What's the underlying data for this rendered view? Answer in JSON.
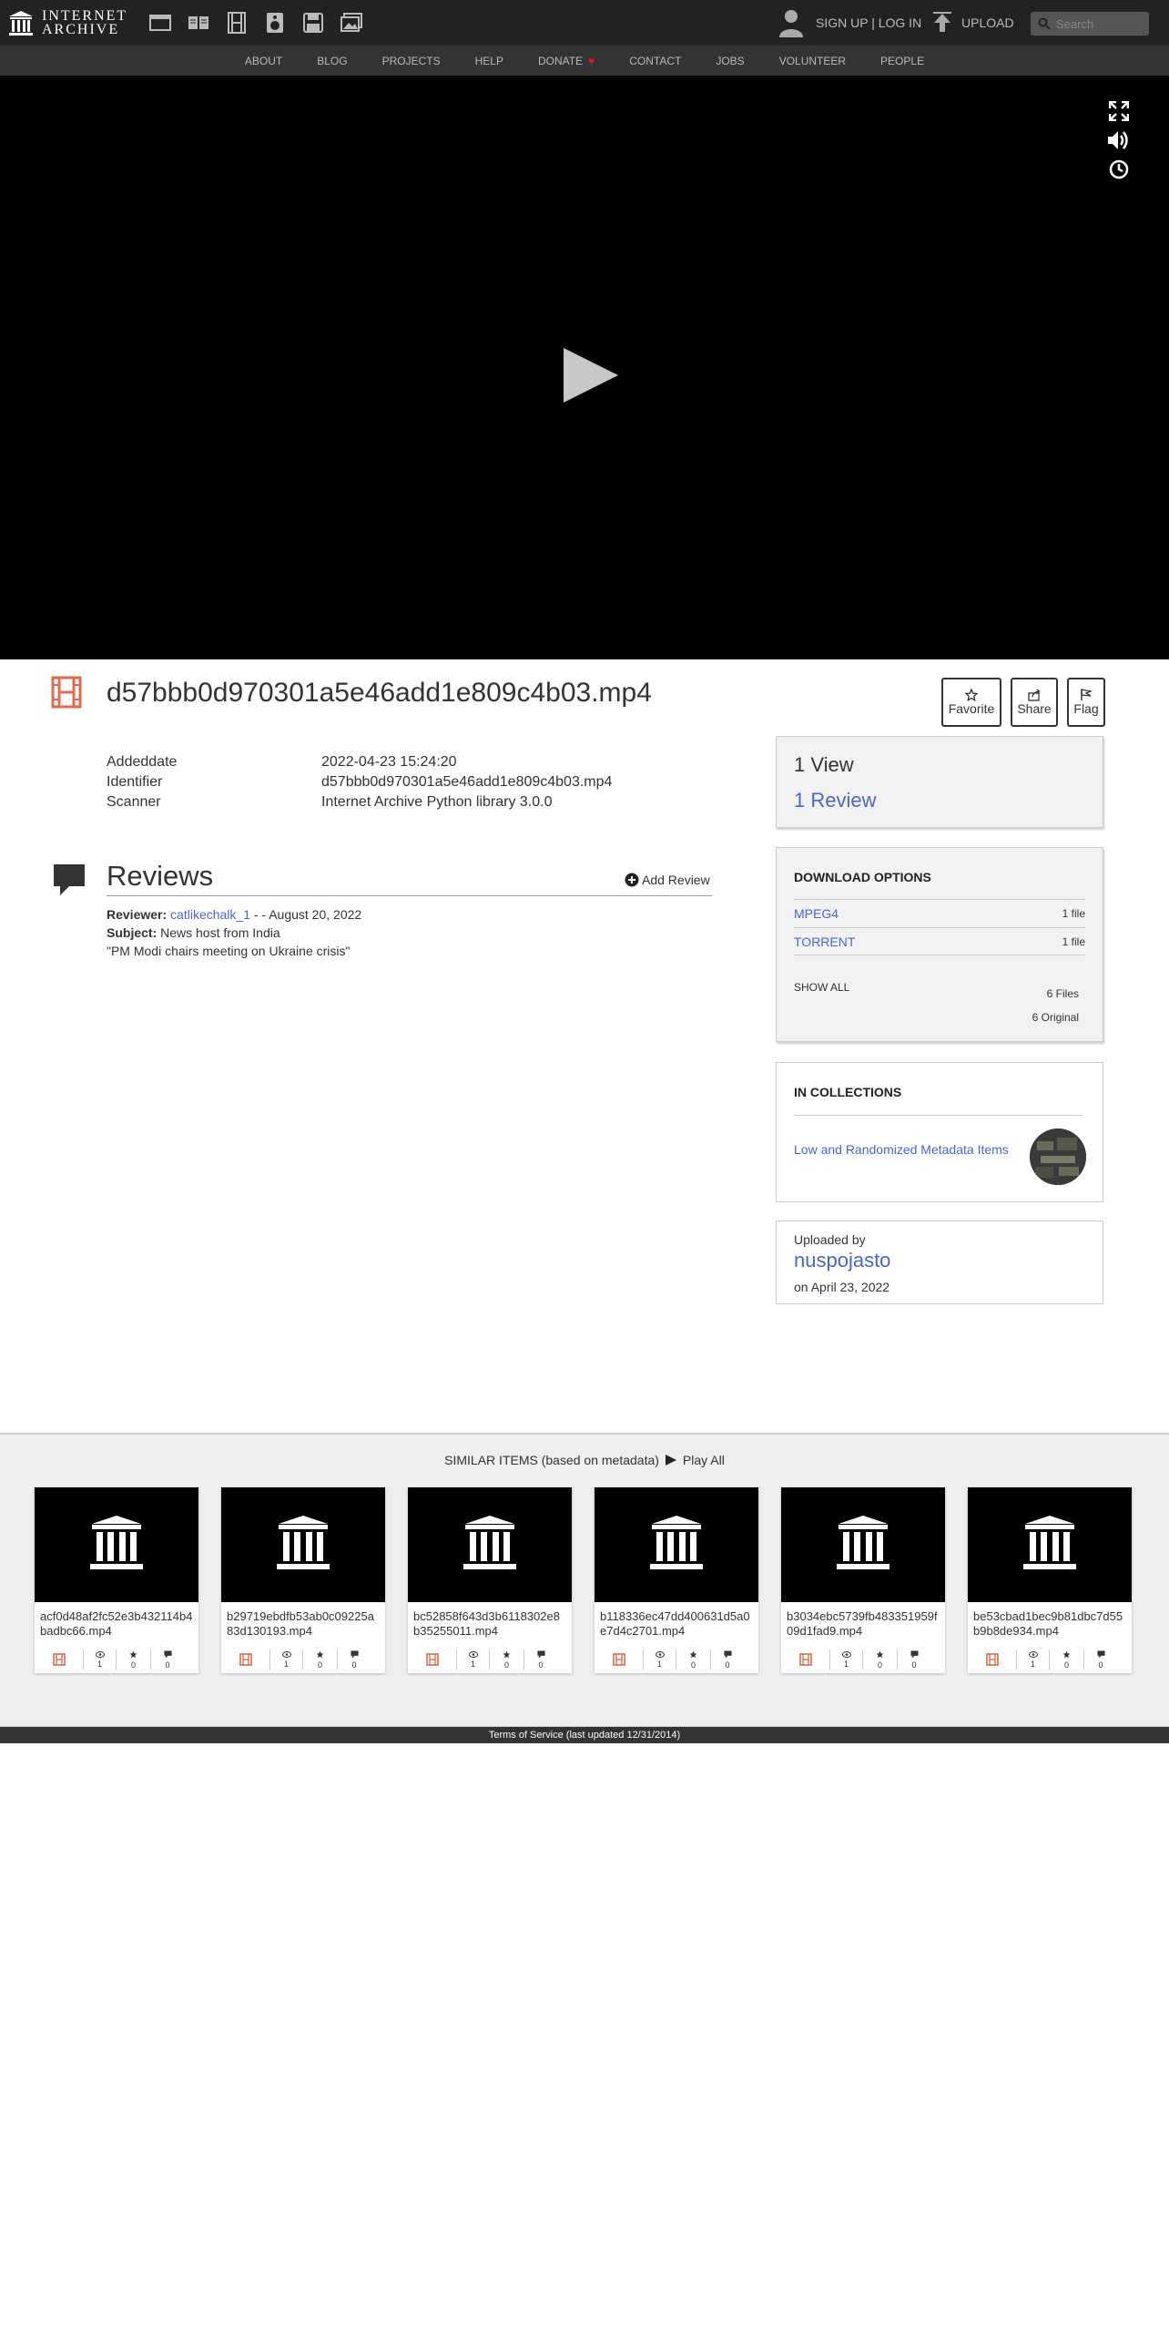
{
  "header": {
    "logo_line1": "INTERNET",
    "logo_line2": "ARCHIVE",
    "media_icons": [
      "web-icon",
      "texts-icon",
      "video-icon",
      "audio-icon",
      "software-icon",
      "images-icon"
    ],
    "signup_login": "SIGN UP | LOG IN",
    "upload": "UPLOAD",
    "search_placeholder": "Search"
  },
  "subnav": {
    "items": [
      "ABOUT",
      "BLOG",
      "PROJECTS",
      "HELP",
      "DONATE",
      "CONTACT",
      "JOBS",
      "VOLUNTEER",
      "PEOPLE"
    ],
    "donate_heart": "♥"
  },
  "item": {
    "title": "d57bbb0d970301a5e46add1e809c4b03.mp4",
    "actions": [
      "Favorite",
      "Share",
      "Flag"
    ],
    "metadata": [
      {
        "key": "Addeddate",
        "value": "2022-04-23 15:24:20"
      },
      {
        "key": "Identifier",
        "value": "d57bbb0d970301a5e46add1e809c4b03.mp4"
      },
      {
        "key": "Scanner",
        "value": "Internet Archive Python library 3.0.0"
      }
    ]
  },
  "reviews": {
    "title": "Reviews",
    "add_review": "Add Review",
    "reviewer_label": "Reviewer:",
    "reviewer": "catlikechalk_1",
    "date": "- - August 20, 2022",
    "subject_label": "Subject:",
    "subject": "News host from India",
    "body": "\"PM Modi chairs meeting on Ukraine crisis\""
  },
  "stats": {
    "views": "1 View",
    "reviews": "1 Review"
  },
  "downloads": {
    "heading": "DOWNLOAD OPTIONS",
    "rows": [
      {
        "label": "MPEG4",
        "count": "1 file"
      },
      {
        "label": "TORRENT",
        "count": "1 file"
      }
    ],
    "show_all": "SHOW ALL",
    "files": "6 Files",
    "original": "6 Original"
  },
  "collections": {
    "heading": "IN COLLECTIONS",
    "name": "Low and Randomized Metadata Items"
  },
  "uploader": {
    "label": "Uploaded by",
    "name": "nuspojasto",
    "date": "on April 23, 2022"
  },
  "similar": {
    "heading": "SIMILAR ITEMS (based on metadata)",
    "play_all": "Play All",
    "items": [
      {
        "name": "acf0d48af2fc52e3b432114b4badbc66.mp4",
        "views": "1",
        "favs": "0",
        "reviews": "0"
      },
      {
        "name": "b29719ebdfb53ab0c09225a83d130193.mp4",
        "views": "1",
        "favs": "0",
        "reviews": "0"
      },
      {
        "name": "bc52858f643d3b6118302e8b35255011.mp4",
        "views": "1",
        "favs": "0",
        "reviews": "0"
      },
      {
        "name": "b118336ec47dd400631d5a0e7d4c2701.mp4",
        "views": "1",
        "favs": "0",
        "reviews": "0"
      },
      {
        "name": "b3034ebc5739fb483351959f09d1fad9.mp4",
        "views": "1",
        "favs": "0",
        "reviews": "0"
      },
      {
        "name": "be53cbad1bec9b81dbc7d55b9b8de934.mp4",
        "views": "1",
        "favs": "0",
        "reviews": "0"
      }
    ]
  },
  "footer": {
    "text": "Terms of Service (last updated 12/31/2014)"
  },
  "colors": {
    "topbar": "#222222",
    "subnav": "#333333",
    "link": "#4b64d2",
    "film_icon": "#e06b4c",
    "heart": "#e31b1b"
  }
}
